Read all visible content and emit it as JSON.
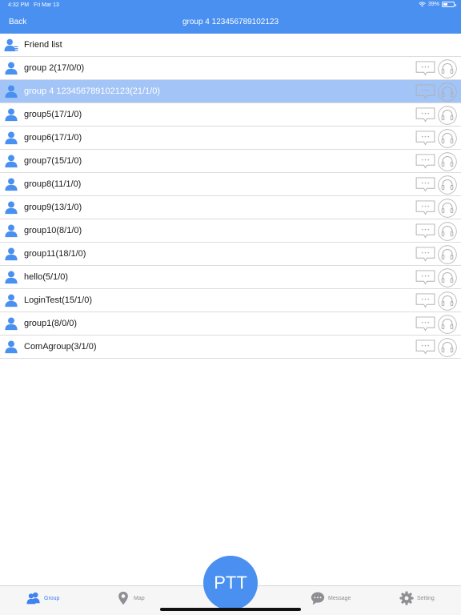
{
  "status_bar": {
    "time": "4:32 PM",
    "date": "Fri Mar 13",
    "battery": "39%"
  },
  "nav": {
    "back_label": "Back",
    "title": "group 4 123456789102123"
  },
  "friend_list_label": "Friend list",
  "groups": [
    {
      "label": "group 2(17/0/0)",
      "selected": false
    },
    {
      "label": "group 4 123456789102123(21/1/0)",
      "selected": true
    },
    {
      "label": "group5(17/1/0)",
      "selected": false
    },
    {
      "label": "group6(17/1/0)",
      "selected": false
    },
    {
      "label": "group7(15/1/0)",
      "selected": false
    },
    {
      "label": "group8(11/1/0)",
      "selected": false
    },
    {
      "label": "group9(13/1/0)",
      "selected": false
    },
    {
      "label": "group10(8/1/0)",
      "selected": false
    },
    {
      "label": "group11(18/1/0)",
      "selected": false
    },
    {
      "label": "hello(5/1/0)",
      "selected": false
    },
    {
      "label": "LoginTest(15/1/0)",
      "selected": false
    },
    {
      "label": "group1(8/0/0)",
      "selected": false
    },
    {
      "label": "ComAgroup(3/1/0)",
      "selected": false
    }
  ],
  "ptt_label": "PTT",
  "tabs": {
    "group": "Group",
    "map": "Map",
    "message": "Message",
    "setting": "Setting"
  },
  "colors": {
    "accent": "#4a90f0",
    "selected_row": "#a3c4f7",
    "icon_gray": "#b0b0b0"
  }
}
